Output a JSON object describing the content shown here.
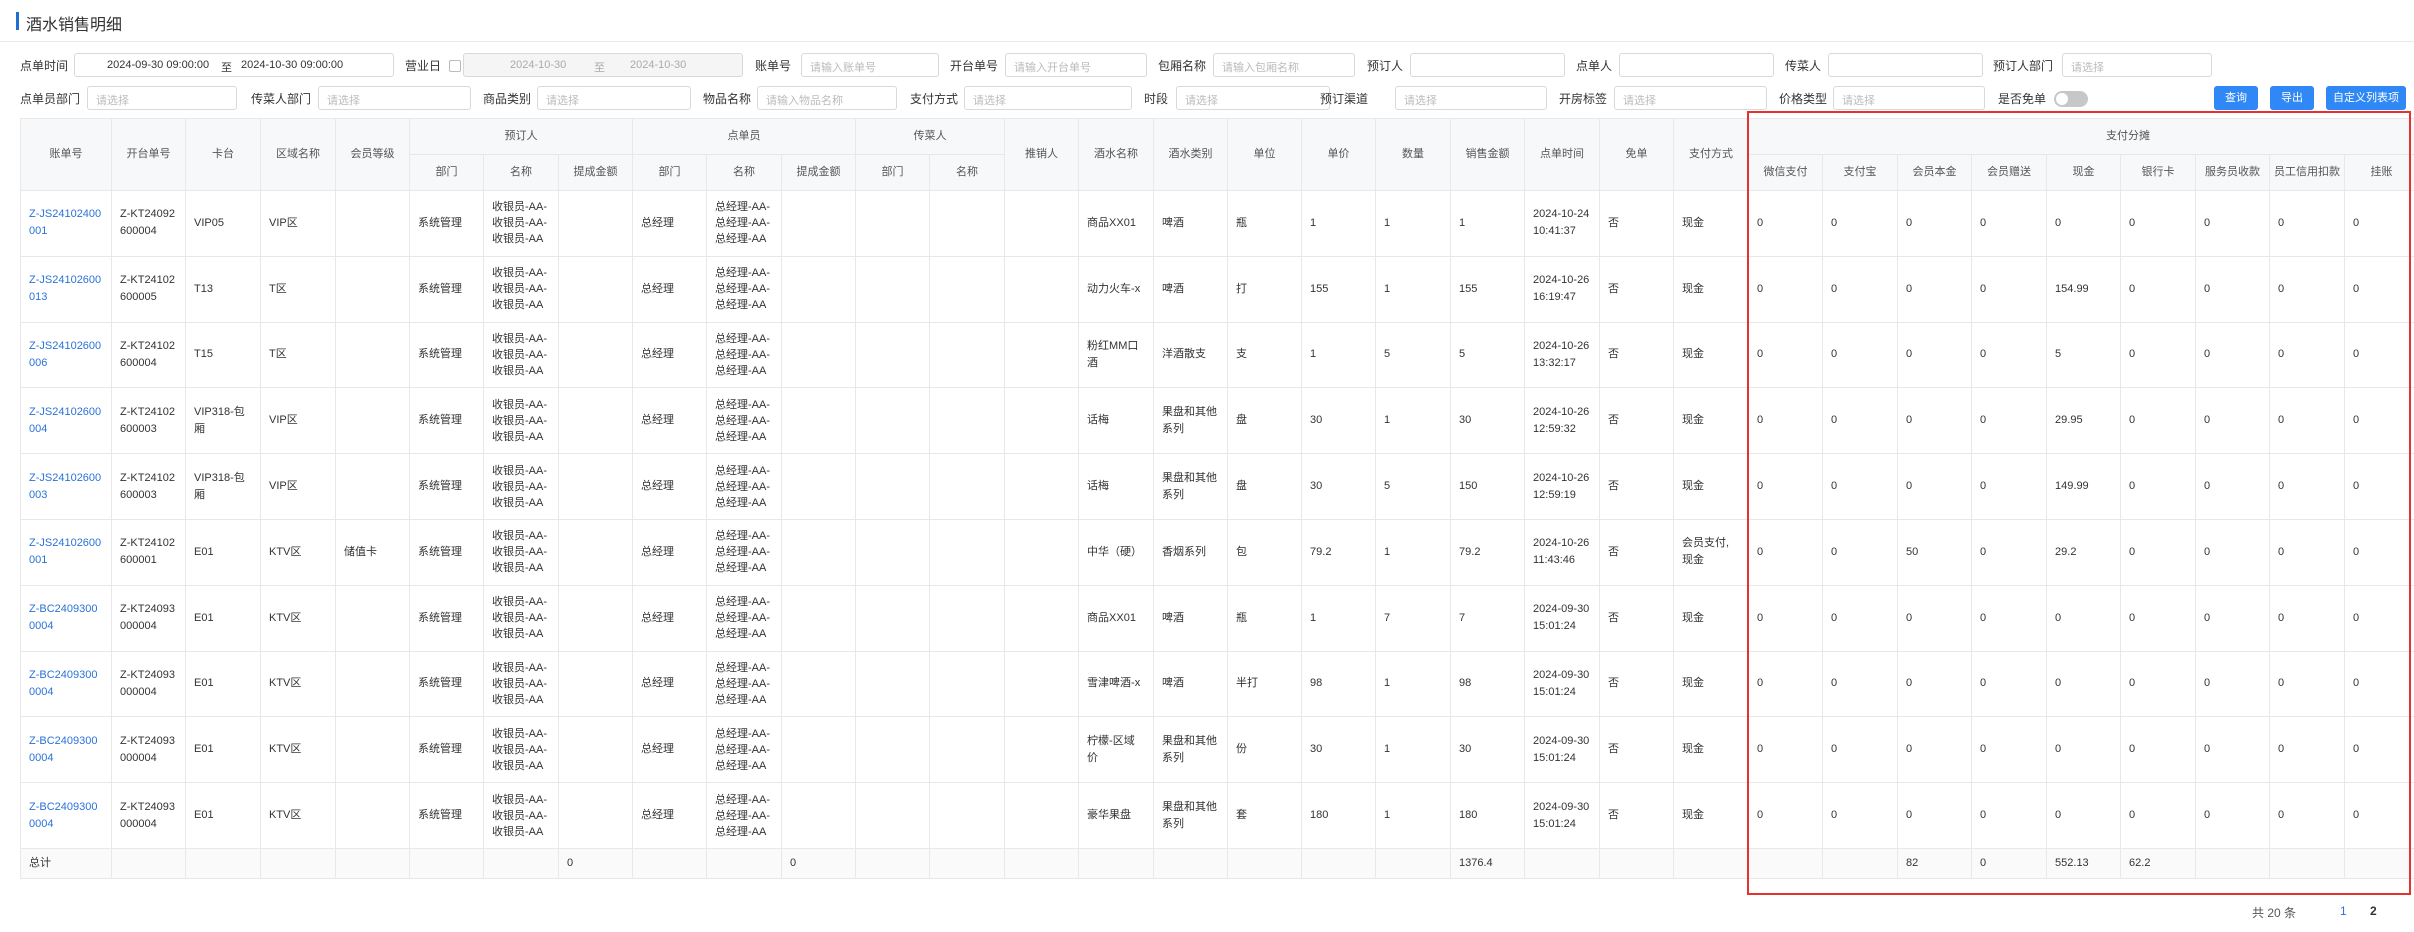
{
  "page": {
    "title": "酒水销售明细"
  },
  "filters": {
    "order_time": {
      "label": "点单时间",
      "start": "2024-09-30 09:00:00",
      "sep": "至",
      "end": "2024-10-30 09:00:00"
    },
    "business_day": {
      "label": "营业日",
      "start": "2024-10-30",
      "sep": "至",
      "end": "2024-10-30"
    },
    "bill_no": {
      "label": "账单号",
      "placeholder": "请输入账单号"
    },
    "open_no": {
      "label": "开台单号",
      "placeholder": "请输入开台单号"
    },
    "room_name": {
      "label": "包厢名称",
      "placeholder": "请输入包厢名称"
    },
    "booker": {
      "label": "预订人"
    },
    "orderer": {
      "label": "点单人"
    },
    "server": {
      "label": "传菜人"
    },
    "booker_dept": {
      "label": "预订人部门",
      "placeholder": "请选择"
    },
    "orderer_dept": {
      "label": "点单员部门",
      "placeholder": "请选择"
    },
    "server_dept": {
      "label": "传菜人部门",
      "placeholder": "请选择"
    },
    "goods_category": {
      "label": "商品类别",
      "placeholder": "请选择"
    },
    "item_name": {
      "label": "物品名称",
      "placeholder": "请输入物品名称"
    },
    "pay_method": {
      "label": "支付方式",
      "placeholder": "请选择"
    },
    "period": {
      "label": "时段",
      "placeholder": "请选择"
    },
    "channel": {
      "label": "预订渠道",
      "placeholder": "请选择"
    },
    "room_tag": {
      "label": "开房标签",
      "placeholder": "请选择"
    },
    "price_type": {
      "label": "价格类型",
      "placeholder": "请选择"
    },
    "is_free": {
      "label": "是否免单"
    }
  },
  "buttons": {
    "query": "查询",
    "export": "导出",
    "custom_columns": "自定义列表项"
  },
  "table": {
    "group_headers": {
      "booker": "预订人",
      "orderer": "点单员",
      "server": "传菜人",
      "payment": "支付分摊"
    },
    "columns": {
      "bill_no": "账单号",
      "open_no": "开台单号",
      "table": "卡台",
      "area": "区域名称",
      "member_level": "会员等级",
      "dept": "部门",
      "name": "名称",
      "commission": "提成金额",
      "seller": "推销人",
      "drink_name": "酒水名称",
      "drink_type": "酒水类别",
      "unit": "单位",
      "price": "单价",
      "qty": "数量",
      "amount": "销售金额",
      "order_time": "点单时间",
      "free": "免单",
      "pay_method": "支付方式",
      "wechat": "微信支付",
      "alipay": "支付宝",
      "member_principal": "会员本金",
      "member_gift": "会员赠送",
      "cash": "现金",
      "card": "银行卡",
      "service_collect": "服务员收款",
      "staff_consume": "员工信用扣款",
      "waive": "挂账"
    },
    "rows": [
      {
        "bill_no": "Z-JS24102400001",
        "open_no": "Z-KT24092600004",
        "table": "VIP05",
        "area": "VIP区",
        "member_level": "",
        "b_dept": "系统管理",
        "b_name": "收银员-AA-收银员-AA-收银员-AA",
        "b_comm": "",
        "o_dept": "总经理",
        "o_name": "总经理-AA-总经理-AA-总经理-AA",
        "o_comm": "",
        "s_dept": "",
        "s_name": "",
        "seller": "",
        "drink_name": "商品XX01",
        "drink_type": "啤酒",
        "unit": "瓶",
        "price": "1",
        "qty": "1",
        "amount": "1",
        "order_time": "2024-10-24 10:41:37",
        "free": "否",
        "pay_method": "现金",
        "wechat": "0",
        "alipay": "0",
        "member_principal": "0",
        "member_gift": "0",
        "cash": "0",
        "card": "0",
        "service_collect": "0",
        "staff_consume": "0",
        "waive": "0"
      },
      {
        "bill_no": "Z-JS24102600013",
        "open_no": "Z-KT24102600005",
        "table": "T13",
        "area": "T区",
        "member_level": "",
        "b_dept": "系统管理",
        "b_name": "收银员-AA-收银员-AA-收银员-AA",
        "b_comm": "",
        "o_dept": "总经理",
        "o_name": "总经理-AA-总经理-AA-总经理-AA",
        "o_comm": "",
        "s_dept": "",
        "s_name": "",
        "seller": "",
        "drink_name": "动力火车-x",
        "drink_type": "啤酒",
        "unit": "打",
        "price": "155",
        "qty": "1",
        "amount": "155",
        "order_time": "2024-10-26 16:19:47",
        "free": "否",
        "pay_method": "现金",
        "wechat": "0",
        "alipay": "0",
        "member_principal": "0",
        "member_gift": "0",
        "cash": "154.99",
        "card": "0",
        "service_collect": "0",
        "staff_consume": "0",
        "waive": "0"
      },
      {
        "bill_no": "Z-JS24102600006",
        "open_no": "Z-KT24102600004",
        "table": "T15",
        "area": "T区",
        "member_level": "",
        "b_dept": "系统管理",
        "b_name": "收银员-AA-收银员-AA-收银员-AA",
        "b_comm": "",
        "o_dept": "总经理",
        "o_name": "总经理-AA-总经理-AA-总经理-AA",
        "o_comm": "",
        "s_dept": "",
        "s_name": "",
        "seller": "",
        "drink_name": "粉红MM口酒",
        "drink_type": "洋酒散支",
        "unit": "支",
        "price": "1",
        "qty": "5",
        "amount": "5",
        "order_time": "2024-10-26 13:32:17",
        "free": "否",
        "pay_method": "现金",
        "wechat": "0",
        "alipay": "0",
        "member_principal": "0",
        "member_gift": "0",
        "cash": "5",
        "card": "0",
        "service_collect": "0",
        "staff_consume": "0",
        "waive": "0"
      },
      {
        "bill_no": "Z-JS24102600004",
        "open_no": "Z-KT24102600003",
        "table": "VIP318-包厢",
        "area": "VIP区",
        "member_level": "",
        "b_dept": "系统管理",
        "b_name": "收银员-AA-收银员-AA-收银员-AA",
        "b_comm": "",
        "o_dept": "总经理",
        "o_name": "总经理-AA-总经理-AA-总经理-AA",
        "o_comm": "",
        "s_dept": "",
        "s_name": "",
        "seller": "",
        "drink_name": "话梅",
        "drink_type": "果盘和其他系列",
        "unit": "盘",
        "price": "30",
        "qty": "1",
        "amount": "30",
        "order_time": "2024-10-26 12:59:32",
        "free": "否",
        "pay_method": "现金",
        "wechat": "0",
        "alipay": "0",
        "member_principal": "0",
        "member_gift": "0",
        "cash": "29.95",
        "card": "0",
        "service_collect": "0",
        "staff_consume": "0",
        "waive": "0"
      },
      {
        "bill_no": "Z-JS24102600003",
        "open_no": "Z-KT24102600003",
        "table": "VIP318-包厢",
        "area": "VIP区",
        "member_level": "",
        "b_dept": "系统管理",
        "b_name": "收银员-AA-收银员-AA-收银员-AA",
        "b_comm": "",
        "o_dept": "总经理",
        "o_name": "总经理-AA-总经理-AA-总经理-AA",
        "o_comm": "",
        "s_dept": "",
        "s_name": "",
        "seller": "",
        "drink_name": "话梅",
        "drink_type": "果盘和其他系列",
        "unit": "盘",
        "price": "30",
        "qty": "5",
        "amount": "150",
        "order_time": "2024-10-26 12:59:19",
        "free": "否",
        "pay_method": "现金",
        "wechat": "0",
        "alipay": "0",
        "member_principal": "0",
        "member_gift": "0",
        "cash": "149.99",
        "card": "0",
        "service_collect": "0",
        "staff_consume": "0",
        "waive": "0"
      },
      {
        "bill_no": "Z-JS24102600001",
        "open_no": "Z-KT24102600001",
        "table": "E01",
        "area": "KTV区",
        "member_level": "储值卡",
        "b_dept": "系统管理",
        "b_name": "收银员-AA-收银员-AA-收银员-AA",
        "b_comm": "",
        "o_dept": "总经理",
        "o_name": "总经理-AA-总经理-AA-总经理-AA",
        "o_comm": "",
        "s_dept": "",
        "s_name": "",
        "seller": "",
        "drink_name": "中华（硬）",
        "drink_type": "香烟系列",
        "unit": "包",
        "price": "79.2",
        "qty": "1",
        "amount": "79.2",
        "order_time": "2024-10-26 11:43:46",
        "free": "否",
        "pay_method": "会员支付,现金",
        "wechat": "0",
        "alipay": "0",
        "member_principal": "50",
        "member_gift": "0",
        "cash": "29.2",
        "card": "0",
        "service_collect": "0",
        "staff_consume": "0",
        "waive": "0"
      },
      {
        "bill_no": "Z-BC24093000004",
        "open_no": "Z-KT24093000004",
        "table": "E01",
        "area": "KTV区",
        "member_level": "",
        "b_dept": "系统管理",
        "b_name": "收银员-AA-收银员-AA-收银员-AA",
        "b_comm": "",
        "o_dept": "总经理",
        "o_name": "总经理-AA-总经理-AA-总经理-AA",
        "o_comm": "",
        "s_dept": "",
        "s_name": "",
        "seller": "",
        "drink_name": "商品XX01",
        "drink_type": "啤酒",
        "unit": "瓶",
        "price": "1",
        "qty": "7",
        "amount": "7",
        "order_time": "2024-09-30 15:01:24",
        "free": "否",
        "pay_method": "现金",
        "wechat": "0",
        "alipay": "0",
        "member_principal": "0",
        "member_gift": "0",
        "cash": "0",
        "card": "0",
        "service_collect": "0",
        "staff_consume": "0",
        "waive": "0"
      },
      {
        "bill_no": "Z-BC24093000004",
        "open_no": "Z-KT24093000004",
        "table": "E01",
        "area": "KTV区",
        "member_level": "",
        "b_dept": "系统管理",
        "b_name": "收银员-AA-收银员-AA-收银员-AA",
        "b_comm": "",
        "o_dept": "总经理",
        "o_name": "总经理-AA-总经理-AA-总经理-AA",
        "o_comm": "",
        "s_dept": "",
        "s_name": "",
        "seller": "",
        "drink_name": "雪津啤酒-x",
        "drink_type": "啤酒",
        "unit": "半打",
        "price": "98",
        "qty": "1",
        "amount": "98",
        "order_time": "2024-09-30 15:01:24",
        "free": "否",
        "pay_method": "现金",
        "wechat": "0",
        "alipay": "0",
        "member_principal": "0",
        "member_gift": "0",
        "cash": "0",
        "card": "0",
        "service_collect": "0",
        "staff_consume": "0",
        "waive": "0"
      },
      {
        "bill_no": "Z-BC24093000004",
        "open_no": "Z-KT24093000004",
        "table": "E01",
        "area": "KTV区",
        "member_level": "",
        "b_dept": "系统管理",
        "b_name": "收银员-AA-收银员-AA-收银员-AA",
        "b_comm": "",
        "o_dept": "总经理",
        "o_name": "总经理-AA-总经理-AA-总经理-AA",
        "o_comm": "",
        "s_dept": "",
        "s_name": "",
        "seller": "",
        "drink_name": "柠檬-区域价",
        "drink_type": "果盘和其他系列",
        "unit": "份",
        "price": "30",
        "qty": "1",
        "amount": "30",
        "order_time": "2024-09-30 15:01:24",
        "free": "否",
        "pay_method": "现金",
        "wechat": "0",
        "alipay": "0",
        "member_principal": "0",
        "member_gift": "0",
        "cash": "0",
        "card": "0",
        "service_collect": "0",
        "staff_consume": "0",
        "waive": "0"
      },
      {
        "bill_no": "Z-BC24093000004",
        "open_no": "Z-KT24093000004",
        "table": "E01",
        "area": "KTV区",
        "member_level": "",
        "b_dept": "系统管理",
        "b_name": "收银员-AA-收银员-AA-收银员-AA",
        "b_comm": "",
        "o_dept": "总经理",
        "o_name": "总经理-AA-总经理-AA-总经理-AA",
        "o_comm": "",
        "s_dept": "",
        "s_name": "",
        "seller": "",
        "drink_name": "豪华果盘",
        "drink_type": "果盘和其他系列",
        "unit": "套",
        "price": "180",
        "qty": "1",
        "amount": "180",
        "order_time": "2024-09-30 15:01:24",
        "free": "否",
        "pay_method": "现金",
        "wechat": "0",
        "alipay": "0",
        "member_principal": "0",
        "member_gift": "0",
        "cash": "0",
        "card": "0",
        "service_collect": "0",
        "staff_consume": "0",
        "waive": "0"
      }
    ],
    "summary": {
      "label": "总计",
      "b_comm": "0",
      "o_comm": "0",
      "amount": "1376.4",
      "member_principal": "82",
      "member_gift": "0",
      "cash": "552.13",
      "card": "62.2"
    }
  },
  "pager": {
    "total": "共 20 条",
    "pages": [
      "1",
      "2"
    ],
    "current": "2"
  },
  "colors": {
    "accent": "#2f88f5",
    "link": "#2a73d6",
    "highlight_box": "#e5322d"
  }
}
